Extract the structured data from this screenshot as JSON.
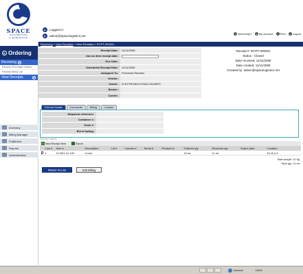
{
  "header": {
    "logo_word": "SPACE",
    "logo_sub_1": "DISTRIBUTION",
    "logo_sub_2": "& WAREHOUSE",
    "logged_in_label": "Logged in:",
    "user_email": "admin@spacelogistics.net",
    "top_links": [
      "Need help?",
      "My Account",
      "Print",
      "Logout"
    ]
  },
  "breadcrumb": {
    "items": [
      "Receiving",
      "View Receipts",
      "View Receipts"
    ],
    "current": "RCPT-000001",
    "sep": ">"
  },
  "sidebar": {
    "title": "Ordering",
    "section_receiving": "Receiving",
    "items": [
      "Receive Purchase Orders",
      "Receipt Items List"
    ],
    "section_view": "View Receipts",
    "modules": [
      "Inventory",
      "Billing Manager",
      "Fulfillment",
      "Reports",
      "Administration"
    ]
  },
  "form": {
    "rows": [
      {
        "label": "Receipt Date:",
        "value": "11/11/2008"
      },
      {
        "label": "Use as item receipt date:",
        "value": ""
      },
      {
        "label": "Due Date:",
        "value": ""
      },
      {
        "label": "Scheduled Receipt Date:",
        "value": "11/11/2008"
      },
      {
        "label": "Assigned To:",
        "value": "Fernando Ramirez"
      },
      {
        "label": "Vendor:",
        "value": ""
      },
      {
        "label": "Owner:",
        "value": "FLEXTRONICS ENCLOSURES"
      },
      {
        "label": "Broker:",
        "value": ""
      },
      {
        "label": "Carrier:",
        "value": ""
      }
    ]
  },
  "receipt_info": {
    "number": "Receipt #: RCPT-000001",
    "status": "Status : Closed",
    "date_received": "Date received: 11/11/2008",
    "date_created": "Date created: 11/11/2008",
    "created_by": "Created by: admin@spacelogistics.net"
  },
  "tabs": [
    "Receipt Details",
    "Comments",
    "Billing",
    "Custom"
  ],
  "tab_rows": [
    "Shipment reference:",
    "Container #:",
    "Dock #:",
    "Bill of lading:"
  ],
  "items": {
    "title": "Receipt Items",
    "new_item": "New Receipt Item",
    "export": "Export",
    "columns": [
      "",
      "Line #",
      "Item #",
      "Description",
      "Lot #",
      "License #",
      "Serial #",
      "Product id",
      "Ordered qty",
      "Received qty",
      "Expire date",
      "Location"
    ],
    "rows": [
      [
        "",
        "1",
        "CLI201-01-100",
        "Cover",
        "",
        "",
        "",
        "",
        "10 ea",
        "11 ea",
        "",
        "D1-B-4-5"
      ]
    ],
    "total_weight": "Total weight: 12 kg",
    "total_qty": "Total qty: 11 ea"
  },
  "buttons": {
    "return": "Return To List",
    "edit_billing": "Edit Billing"
  },
  "statusbar": {
    "zone": "Internet",
    "zoom": "100%"
  },
  "colors": {
    "navy": "#17306f",
    "accent": "#3366cc",
    "teal_border": "#39a9b5"
  }
}
